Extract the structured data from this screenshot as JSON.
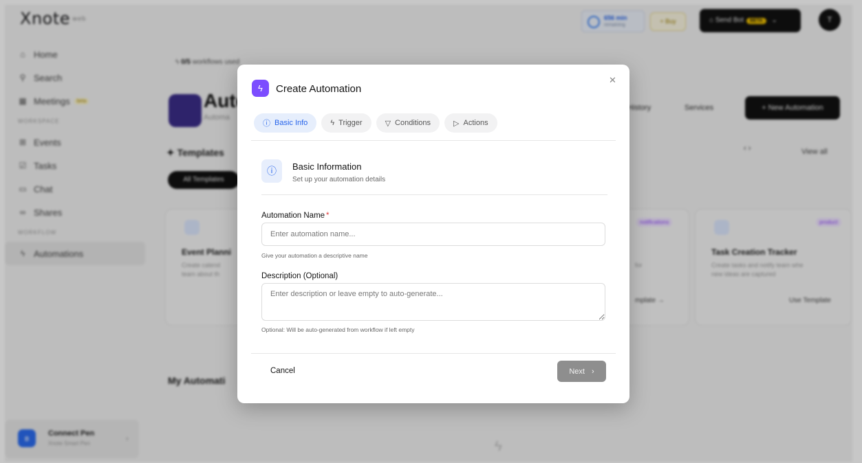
{
  "app": {
    "logo": "Xnote",
    "logo_sub": "web"
  },
  "topbar": {
    "minutes_value": "656 min",
    "minutes_sub": "remaining",
    "buy_label": "+ Buy",
    "sendbot_label": "Send Bot",
    "sendbot_badge": "BETA",
    "avatar_initial": "T"
  },
  "sidebar": {
    "items": [
      {
        "label": "Home",
        "icon": "home-icon"
      },
      {
        "label": "Search",
        "icon": "search-icon"
      },
      {
        "label": "Meetings",
        "icon": "calendar-icon",
        "badge": "beta"
      }
    ],
    "section1": "WORKSPACE",
    "items2": [
      {
        "label": "Events",
        "icon": "grid-icon"
      },
      {
        "label": "Tasks",
        "icon": "checkbox-icon"
      },
      {
        "label": "Chat",
        "icon": "chat-icon"
      },
      {
        "label": "Shares",
        "icon": "link-icon"
      }
    ],
    "section2": "WORKFLOW",
    "active_item": {
      "label": "Automations",
      "icon": "bolt-icon"
    },
    "connect": {
      "title": "Connect Pen",
      "sub": "Xnote Smart Pen"
    }
  },
  "main": {
    "usage": "0/5",
    "usage_suffix": "workflows used",
    "page_title": "Auto",
    "page_sub": "Automa",
    "history_label": "History",
    "services_label": "Services",
    "new_label": "+ New Automation",
    "templates_heading": "Templates",
    "all_templates": "All Templates",
    "view_all": "View all",
    "card1": {
      "title": "Event Planni",
      "desc": "Create calend",
      "desc2": "team about th"
    },
    "card3": {
      "tag": "notifications",
      "desc": "for",
      "use": "mplate →"
    },
    "card4": {
      "tag": "product",
      "title": "Task Creation Tracker",
      "desc": "Create tasks and notify team whe",
      "desc2": "new ideas are captured",
      "use": "Use Template"
    },
    "my_automations": "My Automati"
  },
  "modal": {
    "title": "Create Automation",
    "tabs": [
      {
        "label": "Basic Info",
        "icon": "info-icon"
      },
      {
        "label": "Trigger",
        "icon": "bolt-icon"
      },
      {
        "label": "Conditions",
        "icon": "filter-icon"
      },
      {
        "label": "Actions",
        "icon": "play-icon"
      }
    ],
    "section_title": "Basic Information",
    "section_sub": "Set up your automation details",
    "name_label": "Automation Name",
    "name_required": "*",
    "name_placeholder": "Enter automation name...",
    "name_hint": "Give your automation a descriptive name",
    "desc_label": "Description (Optional)",
    "desc_placeholder": "Enter description or leave empty to auto-generate...",
    "desc_hint": "Optional: Will be auto-generated from workflow if left empty",
    "cancel_label": "Cancel",
    "next_label": "Next"
  }
}
